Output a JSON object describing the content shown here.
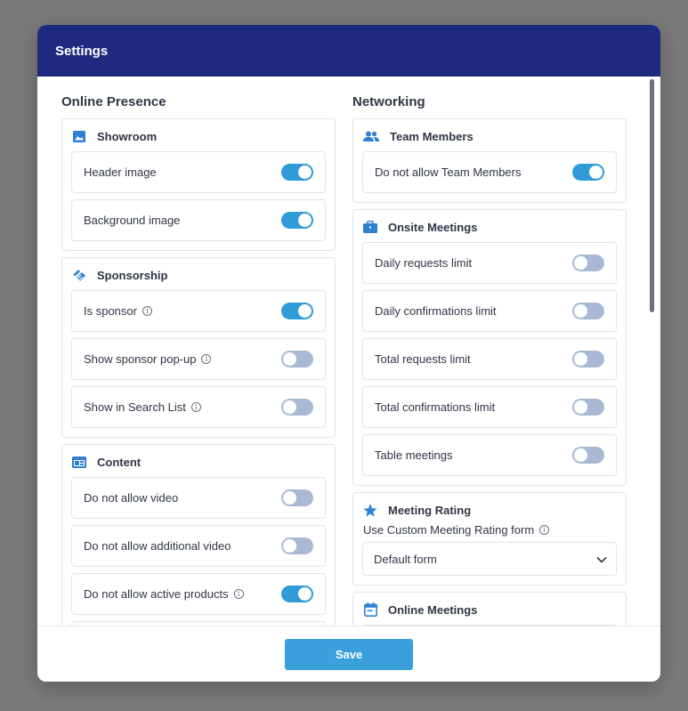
{
  "modal": {
    "title": "Settings"
  },
  "left": {
    "title": "Online Presence",
    "groups": [
      {
        "title": "Showroom",
        "icon": "image-icon",
        "rows": [
          {
            "label": "Header image",
            "on": true,
            "info": false
          },
          {
            "label": "Background image",
            "on": true,
            "info": false
          }
        ]
      },
      {
        "title": "Sponsorship",
        "icon": "handshake-icon",
        "rows": [
          {
            "label": "Is sponsor",
            "on": true,
            "info": true
          },
          {
            "label": "Show sponsor pop-up",
            "on": false,
            "info": true
          },
          {
            "label": "Show in Search List",
            "on": false,
            "info": true
          }
        ]
      },
      {
        "title": "Content",
        "icon": "web-layout-icon",
        "rows": [
          {
            "label": "Do not allow video",
            "on": false,
            "info": false
          },
          {
            "label": "Do not allow additional video",
            "on": false,
            "info": false
          },
          {
            "label": "Do not allow active products",
            "on": true,
            "info": true
          },
          {
            "label": "",
            "on": false,
            "info": false
          }
        ]
      }
    ]
  },
  "right": {
    "title": "Networking",
    "groups": [
      {
        "title": "Team Members",
        "icon": "people-icon",
        "rows": [
          {
            "label": "Do not allow Team Members",
            "on": true,
            "info": false
          }
        ]
      },
      {
        "title": "Onsite Meetings",
        "icon": "briefcase-icon",
        "rows": [
          {
            "label": "Daily requests limit",
            "on": false,
            "info": false
          },
          {
            "label": "Daily confirmations limit",
            "on": false,
            "info": false
          },
          {
            "label": "Total requests limit",
            "on": false,
            "info": false
          },
          {
            "label": "Total confirmations limit",
            "on": false,
            "info": false
          },
          {
            "label": "Table meetings",
            "on": false,
            "info": false
          }
        ]
      }
    ],
    "rating": {
      "title": "Meeting Rating",
      "sub_label": "Use Custom Meeting Rating form",
      "select_value": "Default form"
    },
    "online": {
      "title": "Online Meetings"
    }
  },
  "footer": {
    "save_label": "Save"
  },
  "colors": {
    "header": "#1e2a80",
    "accent": "#2f9cd8",
    "toggle_off": "#a9b9d3",
    "save": "#3aa0dc"
  }
}
